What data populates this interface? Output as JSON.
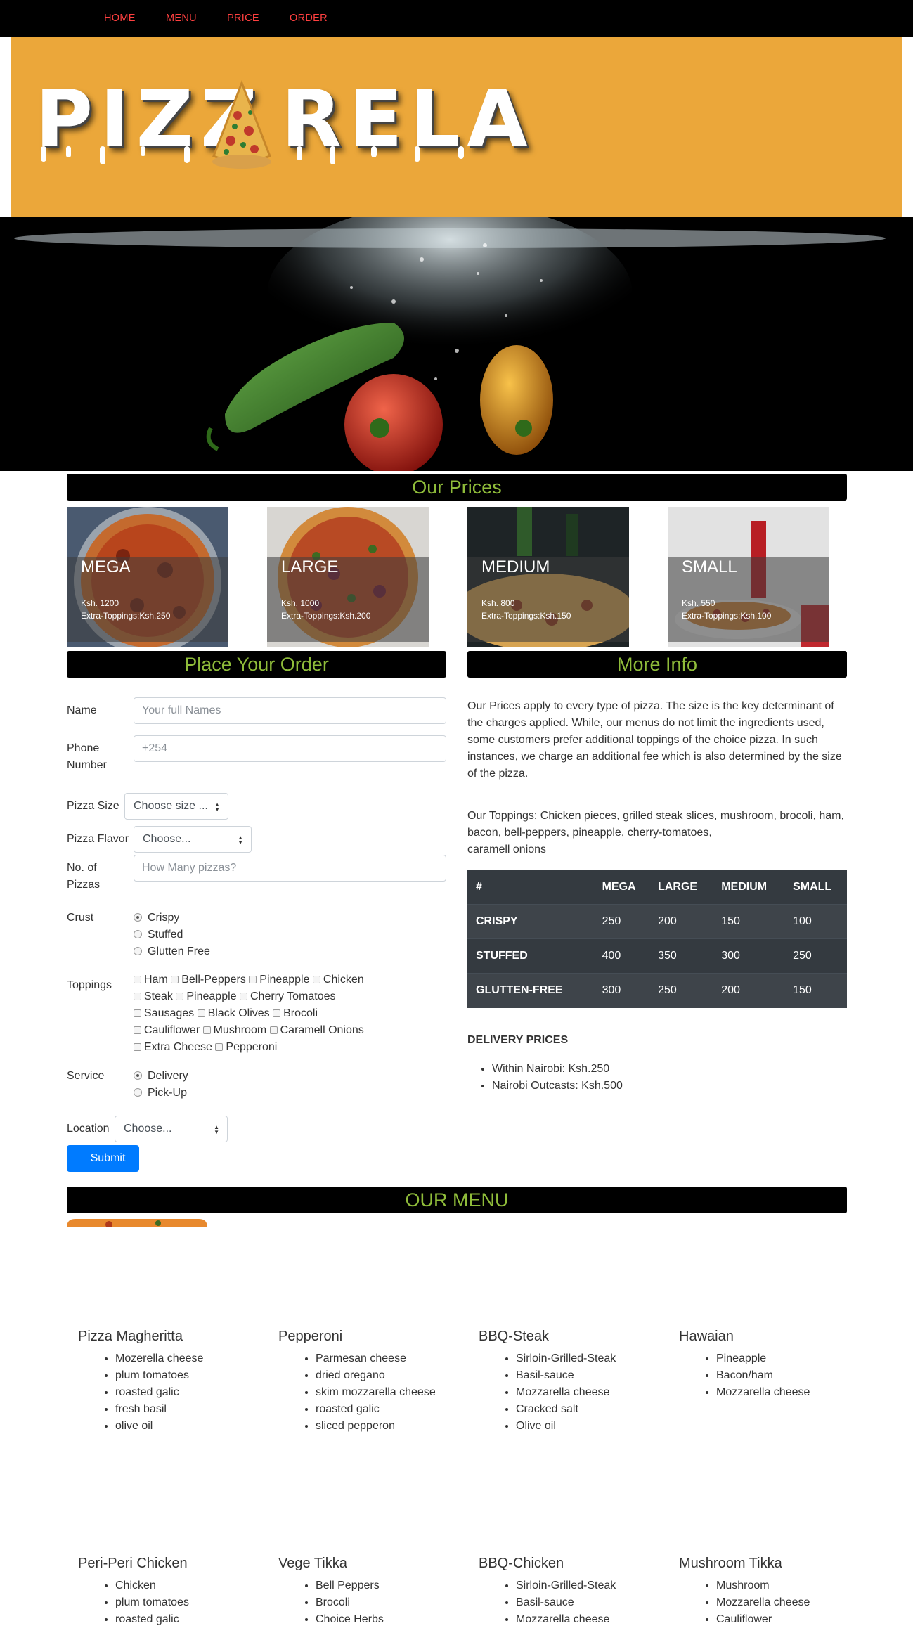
{
  "nav": {
    "items": [
      "HOME",
      "MENU",
      "PRICE",
      "ORDER"
    ]
  },
  "logo": {
    "text": "PIZZA RELA"
  },
  "prices": {
    "title": "Our Prices",
    "cards": [
      {
        "name": "MEGA",
        "price": "Ksh. 1200",
        "extra": "Extra-Toppings:Ksh.250"
      },
      {
        "name": "LARGE",
        "price": "Ksh. 1000",
        "extra": "Extra-Toppings:Ksh.200"
      },
      {
        "name": "MEDIUM",
        "price": "Ksh. 800",
        "extra": "Extra-Toppings:Ksh.150"
      },
      {
        "name": "SMALL",
        "price": "Ksh. 550",
        "extra": "Extra-Toppings:Ksh.100"
      }
    ]
  },
  "order": {
    "title": "Place Your Order",
    "name_label": "Name",
    "name_placeholder": "Your full Names",
    "phone_label": "Phone Number",
    "phone_placeholder": "+254",
    "size_label": "Pizza Size",
    "size_value": "Choose size ...",
    "flavor_label": "Pizza Flavor",
    "flavor_value": "Choose...",
    "count_label": "No. of Pizzas",
    "count_placeholder": "How Many pizzas?",
    "crust_label": "Crust",
    "crust_options": [
      "Crispy",
      "Stuffed",
      "Glutten Free"
    ],
    "crust_selected": "Crispy",
    "toppings_label": "Toppings",
    "toppings_rows": [
      [
        "Ham",
        "Bell-Peppers",
        "Pineapple",
        "Chicken"
      ],
      [
        "Steak",
        "Pineapple",
        "Cherry Tomatoes"
      ],
      [
        "Sausages",
        "Black Olives",
        "Brocoli"
      ],
      [
        "Cauliflower",
        "Mushroom",
        "Caramell Onions"
      ],
      [
        "Extra Cheese",
        "Pepperoni"
      ]
    ],
    "service_label": "Service",
    "service_options": [
      "Delivery",
      "Pick-Up"
    ],
    "service_selected": "Delivery",
    "location_label": "Location",
    "location_value": "Choose...",
    "submit_label": "Submit"
  },
  "info": {
    "title": "More Info",
    "para1": "Our Prices apply to every type of pizza. The size is the key determinant of the charges applied. While, our menus do not limit the ingredients used, some customers prefer additional toppings of the choice pizza. In such instances, we charge an additional fee which is also determined by the size of the pizza.",
    "para2": "Our Toppings: Chicken pieces, grilled steak slices, mushroom, brocoli, ham, bacon, bell-peppers, pineapple, cherry-tomatoes,",
    "para2b": "caramell onions",
    "table": {
      "headers": [
        "#",
        "MEGA",
        "LARGE",
        "MEDIUM",
        "SMALL"
      ],
      "rows": [
        [
          "CRISPY",
          "250",
          "200",
          "150",
          "100"
        ],
        [
          "STUFFED",
          "400",
          "350",
          "300",
          "250"
        ],
        [
          "GLUTTEN-FREE",
          "300",
          "250",
          "200",
          "150"
        ]
      ]
    },
    "delivery_title": "DELIVERY PRICES",
    "delivery_items": [
      "Within Nairobi: Ksh.250",
      "Nairobi Outcasts: Ksh.500"
    ]
  },
  "menu": {
    "title": "OUR MENU",
    "items": [
      {
        "name": "Pizza Magheritta",
        "ingredients": [
          "Mozerella cheese",
          "plum tomatoes",
          "roasted galic",
          "fresh basil",
          "olive oil"
        ]
      },
      {
        "name": "Pepperoni",
        "ingredients": [
          "Parmesan cheese",
          "dried oregano",
          "skim mozzarella cheese",
          "roasted galic",
          "sliced pepperon"
        ]
      },
      {
        "name": "BBQ-Steak",
        "ingredients": [
          "Sirloin-Grilled-Steak",
          "Basil-sauce",
          "Mozzarella cheese",
          "Cracked salt",
          "Olive oil"
        ]
      },
      {
        "name": "Hawaian",
        "ingredients": [
          "Pineapple",
          "Bacon/ham",
          "Mozzarella cheese"
        ]
      },
      {
        "name": "Peri-Peri Chicken",
        "ingredients": [
          "Chicken",
          "plum tomatoes",
          "roasted galic"
        ]
      },
      {
        "name": "Vege Tikka",
        "ingredients": [
          "Bell Peppers",
          "Brocoli",
          "Choice Herbs"
        ]
      },
      {
        "name": "BBQ-Chicken",
        "ingredients": [
          "Sirloin-Grilled-Steak",
          "Basil-sauce",
          "Mozzarella cheese"
        ]
      },
      {
        "name": "Mushroom Tikka",
        "ingredients": [
          "Mushroom",
          "Mozzarella cheese",
          "Cauliflower"
        ]
      }
    ]
  },
  "colors": {
    "nav_link": "#ff4040",
    "banner": "#eba73a",
    "section_title": "#8fbc3a",
    "button": "#007bff",
    "table_bg": "#343a40"
  }
}
